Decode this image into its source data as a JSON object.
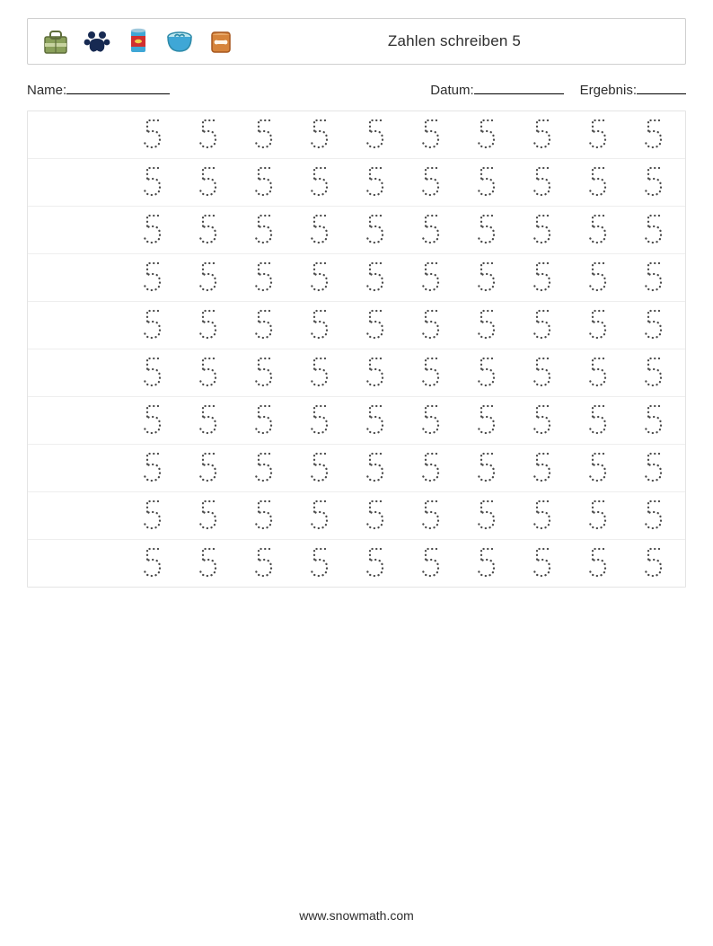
{
  "header": {
    "title": "Zahlen schreiben 5",
    "icons": [
      "bag-icon",
      "paw-icon",
      "can-icon",
      "bowl-icon",
      "treat-bag-icon"
    ]
  },
  "meta": {
    "name_label": "Name:",
    "date_label": "Datum:",
    "result_label": "Ergebnis:"
  },
  "worksheet": {
    "digit": "5",
    "rows": 10,
    "cols": 10
  },
  "footer": {
    "text": "www.snowmath.com"
  }
}
